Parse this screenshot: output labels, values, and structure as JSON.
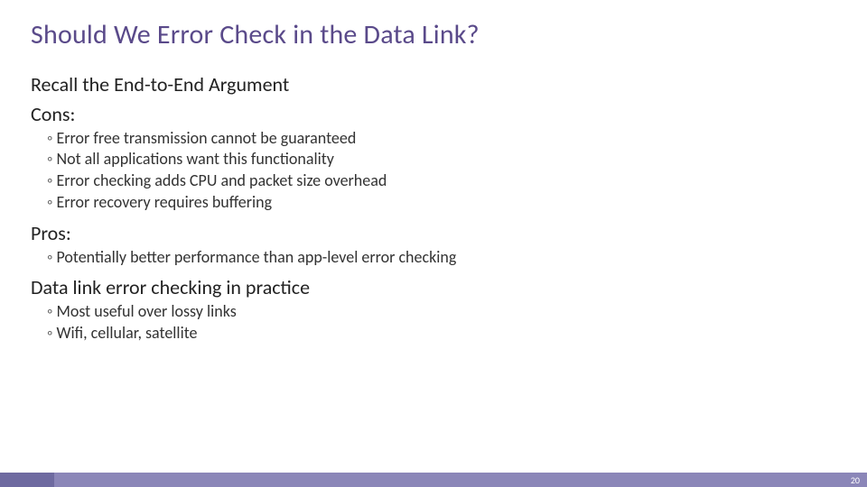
{
  "title": "Should We Error Check in the Data Link?",
  "recall": "Recall the End-to-End Argument",
  "cons": {
    "label": "Cons:",
    "items": [
      "Error free transmission cannot be guaranteed",
      "Not all applications want this functionality",
      "Error checking adds CPU and packet size overhead",
      "Error recovery requires buffering"
    ]
  },
  "pros": {
    "label": "Pros:",
    "items": [
      "Potentially better performance than app-level error checking"
    ]
  },
  "practice": {
    "label": "Data link error checking in practice",
    "items": [
      "Most useful over lossy links",
      "Wifi, cellular, satellite"
    ]
  },
  "page_number": "20"
}
